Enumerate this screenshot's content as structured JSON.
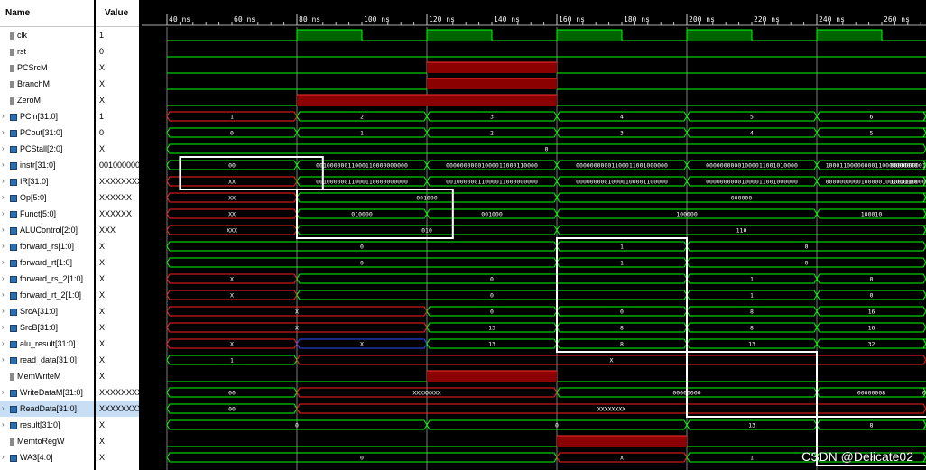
{
  "header": {
    "name_label": "Name",
    "value_label": "Value"
  },
  "time_labels": [
    "40 ns",
    "60 ns",
    "80 ns",
    "100 ns",
    "120 ns",
    "140 ns",
    "160 ns",
    "180 ns",
    "200 ns",
    "220 ns",
    "240 ns",
    "260 ns"
  ],
  "signals": [
    {
      "name": "clk",
      "value": "1",
      "kind": "single",
      "expandable": false
    },
    {
      "name": "rst",
      "value": "0",
      "kind": "single",
      "expandable": false
    },
    {
      "name": "PCSrcM",
      "value": "X",
      "kind": "single",
      "expandable": false
    },
    {
      "name": "BranchM",
      "value": "X",
      "kind": "single",
      "expandable": false
    },
    {
      "name": "ZeroM",
      "value": "X",
      "kind": "single",
      "expandable": false
    },
    {
      "name": "PCin[31:0]",
      "value": "1",
      "kind": "bus",
      "expandable": true
    },
    {
      "name": "PCout[31:0]",
      "value": "0",
      "kind": "bus",
      "expandable": true
    },
    {
      "name": "PCStall[2:0]",
      "value": "X",
      "kind": "bus",
      "expandable": true
    },
    {
      "name": "instr[31:0]",
      "value": "001000000",
      "kind": "bus",
      "expandable": true
    },
    {
      "name": "IR[31:0]",
      "value": "XXXXXXXX",
      "kind": "bus",
      "expandable": true
    },
    {
      "name": "Op[5:0]",
      "value": "XXXXXX",
      "kind": "bus",
      "expandable": true
    },
    {
      "name": "Funct[5:0]",
      "value": "XXXXXX",
      "kind": "bus",
      "expandable": true
    },
    {
      "name": "ALUControl[2:0]",
      "value": "XXX",
      "kind": "bus",
      "expandable": true
    },
    {
      "name": "forward_rs[1:0]",
      "value": "X",
      "kind": "bus",
      "expandable": true
    },
    {
      "name": "forward_rt[1:0]",
      "value": "X",
      "kind": "bus",
      "expandable": true
    },
    {
      "name": "forward_rs_2[1:0]",
      "value": "X",
      "kind": "bus",
      "expandable": true
    },
    {
      "name": "forward_rt_2[1:0]",
      "value": "X",
      "kind": "bus",
      "expandable": true
    },
    {
      "name": "SrcA[31:0]",
      "value": "X",
      "kind": "bus",
      "expandable": true
    },
    {
      "name": "SrcB[31:0]",
      "value": "X",
      "kind": "bus",
      "expandable": true
    },
    {
      "name": "alu_result[31:0]",
      "value": "X",
      "kind": "bus",
      "expandable": true
    },
    {
      "name": "read_data[31:0]",
      "value": "X",
      "kind": "bus",
      "expandable": true
    },
    {
      "name": "MemWriteM",
      "value": "X",
      "kind": "single",
      "expandable": false
    },
    {
      "name": "WriteDataM[31:0]",
      "value": "XXXXXXXX",
      "kind": "bus",
      "expandable": true
    },
    {
      "name": "ReadData[31:0]",
      "value": "XXXXXXXX",
      "kind": "bus",
      "expandable": true,
      "selected": true
    },
    {
      "name": "result[31:0]",
      "value": "X",
      "kind": "bus",
      "expandable": true
    },
    {
      "name": "MemtoRegW",
      "value": "X",
      "kind": "single",
      "expandable": false
    },
    {
      "name": "WA3[4:0]",
      "value": "X",
      "kind": "bus",
      "expandable": true
    }
  ],
  "bus_waves": [
    {
      "row": 5,
      "segs": [
        [
          0,
          1,
          "1",
          1
        ],
        [
          1,
          2,
          "2",
          0
        ],
        [
          2,
          3,
          "3",
          0
        ],
        [
          3,
          4,
          "4",
          0
        ],
        [
          4,
          5,
          "5",
          0
        ],
        [
          5,
          6,
          "6",
          0
        ],
        [
          6,
          7.4,
          "7",
          0
        ]
      ]
    },
    {
      "row": 6,
      "segs": [
        [
          0,
          1,
          "0",
          0
        ],
        [
          1,
          2,
          "1",
          0
        ],
        [
          2,
          3,
          "2",
          0
        ],
        [
          3,
          4,
          "3",
          0
        ],
        [
          4,
          5,
          "4",
          0
        ],
        [
          5,
          6,
          "5",
          0
        ],
        [
          6,
          7.4,
          "6",
          0
        ]
      ]
    },
    {
      "row": 7,
      "segs": [
        [
          0,
          7.4,
          "0",
          0
        ]
      ]
    },
    {
      "row": 8,
      "segs": [
        [
          0,
          1,
          "00",
          0
        ],
        [
          1,
          2,
          "00100000011000110000000000",
          0
        ],
        [
          2,
          3,
          "00000000001000011000110000",
          0
        ],
        [
          3,
          4,
          "00000000001100011001000000",
          0
        ],
        [
          4,
          5,
          "00000000001000011001010000",
          0
        ],
        [
          5,
          6,
          "10001100000000110000000000",
          0
        ],
        [
          6,
          7.4,
          "00000000011000011001111000",
          0
        ]
      ]
    },
    {
      "row": 9,
      "segs": [
        [
          0,
          1,
          "XX",
          1
        ],
        [
          1,
          2,
          "00100000011000110000000000",
          0
        ],
        [
          2,
          3,
          "00100000011000011000000000",
          0
        ],
        [
          3,
          4,
          "00000000010000100001100000",
          0
        ],
        [
          4,
          5,
          "00000000001000011001000000",
          0
        ],
        [
          5,
          6,
          "00000000001000001001010000",
          0
        ],
        [
          6,
          7.4,
          "10001100000000110000000000",
          0
        ]
      ]
    },
    {
      "row": 10,
      "segs": [
        [
          0,
          1,
          "XX",
          1
        ],
        [
          1,
          3,
          "001000",
          0
        ],
        [
          3,
          6,
          "000000",
          0
        ],
        [
          6,
          7.4,
          "100011",
          0
        ]
      ]
    },
    {
      "row": 11,
      "segs": [
        [
          0,
          1,
          "XX",
          1
        ],
        [
          1,
          2,
          "010000",
          0
        ],
        [
          2,
          3,
          "001000",
          0
        ],
        [
          3,
          5,
          "100000",
          0
        ],
        [
          5,
          6,
          "100010",
          0
        ],
        [
          6,
          7.4,
          "000001",
          0
        ]
      ]
    },
    {
      "row": 12,
      "segs": [
        [
          0,
          1,
          "XXX",
          1
        ],
        [
          1,
          3,
          "010",
          0
        ],
        [
          3,
          6,
          "110",
          0
        ],
        [
          6,
          7.4,
          "010",
          0
        ]
      ]
    },
    {
      "row": 13,
      "segs": [
        [
          0,
          3,
          "0",
          0
        ],
        [
          3,
          4,
          "1",
          0
        ],
        [
          4,
          7.4,
          "0",
          0
        ]
      ]
    },
    {
      "row": 14,
      "segs": [
        [
          0,
          3,
          "0",
          0
        ],
        [
          3,
          4,
          "1",
          0
        ],
        [
          4,
          7.4,
          "0",
          0
        ]
      ]
    },
    {
      "row": 15,
      "segs": [
        [
          0,
          1,
          "X",
          1
        ],
        [
          1,
          4,
          "0",
          0
        ],
        [
          4,
          5,
          "1",
          0
        ],
        [
          5,
          7.4,
          "0",
          0
        ]
      ]
    },
    {
      "row": 16,
      "segs": [
        [
          0,
          1,
          "X",
          1
        ],
        [
          1,
          4,
          "0",
          0
        ],
        [
          4,
          5,
          "1",
          0
        ],
        [
          5,
          7.4,
          "0",
          0
        ]
      ]
    },
    {
      "row": 17,
      "segs": [
        [
          0,
          2,
          "X",
          1
        ],
        [
          2,
          3,
          "0",
          0
        ],
        [
          3,
          4,
          "0",
          0
        ],
        [
          4,
          5,
          "8",
          0
        ],
        [
          5,
          7.4,
          "16",
          0
        ]
      ]
    },
    {
      "row": 18,
      "segs": [
        [
          0,
          2,
          "X",
          1
        ],
        [
          2,
          3,
          "13",
          0
        ],
        [
          3,
          4,
          "8",
          0
        ],
        [
          4,
          5,
          "8",
          0
        ],
        [
          5,
          7.4,
          "16",
          0
        ]
      ]
    },
    {
      "row": 19,
      "segs": [
        [
          0,
          1,
          "X",
          1
        ],
        [
          1,
          2,
          "X",
          2
        ],
        [
          2,
          3,
          "13",
          0
        ],
        [
          3,
          4,
          "8",
          0
        ],
        [
          4,
          5,
          "13",
          0
        ],
        [
          5,
          6,
          "32",
          0
        ],
        [
          6,
          7.4,
          "0",
          0
        ]
      ]
    },
    {
      "row": 20,
      "segs": [
        [
          0,
          1,
          "1",
          0
        ],
        [
          1,
          7.4,
          "X",
          1
        ]
      ]
    },
    {
      "row": 22,
      "segs": [
        [
          0,
          1,
          "00",
          0
        ],
        [
          1,
          3,
          "XXXXXXXX",
          1
        ],
        [
          3,
          5,
          "00000000",
          0
        ],
        [
          5,
          6,
          "00000008",
          0
        ],
        [
          6,
          7.4,
          "00000010",
          0
        ]
      ]
    },
    {
      "row": 23,
      "segs": [
        [
          0,
          1,
          "00",
          0
        ],
        [
          1,
          7.4,
          "XXXXXXXX",
          1
        ]
      ]
    },
    {
      "row": 24,
      "segs": [
        [
          0,
          2,
          "0",
          0
        ],
        [
          2,
          4,
          "0",
          0
        ],
        [
          4,
          5,
          "13",
          0
        ],
        [
          5,
          6,
          "8",
          0
        ],
        [
          6,
          7.4,
          "16",
          0
        ]
      ]
    },
    {
      "row": 26,
      "segs": [
        [
          0,
          3,
          "0",
          0
        ],
        [
          3,
          4,
          "X",
          1
        ],
        [
          4,
          5,
          "1",
          0
        ],
        [
          5,
          6,
          "2",
          0
        ],
        [
          6,
          7.4,
          "0",
          0
        ]
      ]
    }
  ],
  "bit_waves": [
    {
      "row": 0,
      "segs": [
        [
          0,
          1,
          0
        ],
        [
          1,
          1.5,
          1
        ],
        [
          1.5,
          2,
          0
        ],
        [
          2,
          2.5,
          1
        ],
        [
          2.5,
          3,
          0
        ],
        [
          3,
          3.5,
          1
        ],
        [
          3.5,
          4,
          0
        ],
        [
          4,
          4.5,
          1
        ],
        [
          4.5,
          5,
          0
        ],
        [
          5,
          5.5,
          1
        ],
        [
          5.5,
          6,
          0
        ],
        [
          6,
          6.5,
          1
        ],
        [
          6.5,
          7.4,
          0
        ]
      ]
    },
    {
      "row": 1,
      "segs": [
        [
          0,
          7.4,
          0
        ]
      ]
    },
    {
      "row": 2,
      "segs": [
        [
          0,
          2,
          0
        ],
        [
          2,
          3,
          2
        ],
        [
          3,
          7.4,
          0
        ]
      ]
    },
    {
      "row": 3,
      "segs": [
        [
          0,
          2,
          0
        ],
        [
          2,
          3,
          2
        ],
        [
          3,
          7.4,
          0
        ]
      ]
    },
    {
      "row": 4,
      "segs": [
        [
          0,
          1,
          0
        ],
        [
          1,
          3,
          2
        ],
        [
          3,
          7.4,
          0
        ]
      ]
    },
    {
      "row": 21,
      "segs": [
        [
          0,
          2,
          0
        ],
        [
          2,
          3,
          2
        ],
        [
          3,
          7.4,
          0
        ]
      ]
    },
    {
      "row": 25,
      "segs": [
        [
          0,
          3,
          0
        ],
        [
          3,
          4,
          2
        ],
        [
          4,
          7.4,
          0
        ]
      ]
    }
  ],
  "highlight_boxes": [
    [
      0.1,
      8,
      1.2,
      10
    ],
    [
      1.0,
      10,
      2.2,
      13
    ],
    [
      3.0,
      13,
      4.0,
      20
    ],
    [
      4.0,
      20,
      5.0,
      24
    ],
    [
      5.0,
      24,
      6.0,
      27
    ]
  ],
  "watermark": "CSDN @Delicate02"
}
